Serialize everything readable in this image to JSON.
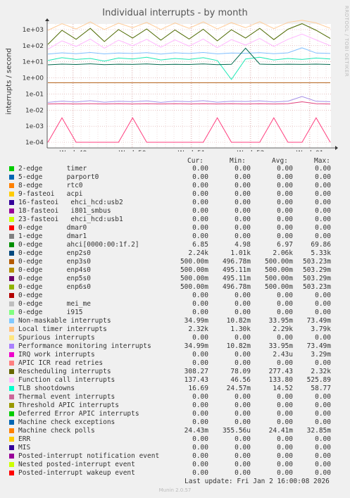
{
  "chart_data": {
    "type": "line",
    "title": "Individual interrupts - by month",
    "ylabel": "interrupts / second",
    "yscale": "log",
    "ylim": [
      0.0001,
      5000
    ],
    "y_ticks": [
      "1e+03",
      "1e+02",
      "1e+01",
      "1e+00",
      "1e-01",
      "1e-02",
      "1e-03",
      "1e-04"
    ],
    "x_ticks": [
      "Week 49",
      "Week 50",
      "Week 51",
      "Week 52",
      "Week 01"
    ],
    "grid": true,
    "series": [
      {
        "name": "Rescheduling interrupts",
        "color": "#4d6a00",
        "avg": 277.43,
        "values": [
          120,
          900,
          250,
          1200,
          180,
          1000,
          300,
          1100,
          220,
          950,
          260,
          1050,
          200,
          980,
          300,
          1200,
          240,
          1050,
          2320,
          900,
          280
        ]
      },
      {
        "name": "Local timer interrupts",
        "color": "#ffcc99",
        "avg": 2290,
        "values": [
          900,
          2300,
          1100,
          3000,
          1000,
          2500,
          1300,
          2800,
          1000,
          2600,
          1200,
          3000,
          1100,
          2700,
          1300,
          3100,
          1150,
          2800,
          3790,
          2600,
          1200
        ]
      },
      {
        "name": "Function call interrupts",
        "color": "#ffb8ff",
        "avg": 133.8,
        "values": [
          60,
          200,
          90,
          260,
          70,
          220,
          100,
          250,
          80,
          230,
          95,
          260,
          75,
          240,
          110,
          280,
          90,
          250,
          525.89,
          230,
          100
        ]
      },
      {
        "name": "Non-maskable interrupts",
        "color": "#7fbfff",
        "avg": 33.95,
        "values": [
          30,
          36,
          32,
          38,
          31,
          35,
          33,
          37,
          30,
          36,
          33,
          38,
          31,
          35,
          34,
          37,
          32,
          36,
          73.49,
          35,
          33
        ]
      },
      {
        "name": "TLB shootdowns",
        "color": "#1ee9b6",
        "avg": 14.52,
        "values": [
          12,
          18,
          14,
          16,
          11,
          17,
          15,
          19,
          13,
          16,
          14,
          18,
          12,
          0.8,
          15,
          19,
          13,
          16,
          14,
          17,
          15
        ]
      },
      {
        "name": "ahci[0000:00:1f.2]",
        "color": "#00694d",
        "avg": 6.97,
        "values": [
          6.5,
          7.2,
          6.8,
          7.5,
          6.6,
          7.1,
          6.9,
          7.4,
          6.7,
          7.0,
          6.8,
          7.3,
          6.6,
          7.0,
          69.86,
          7.2,
          6.8,
          7.1,
          6.9,
          7.2,
          6.85
        ]
      },
      {
        "name": "enp3s0",
        "color": "#b5651d",
        "avg": 0.5,
        "values": [
          0.5,
          0.5,
          0.5,
          0.5,
          0.5,
          0.5,
          0.5,
          0.5,
          0.5,
          0.5,
          0.5,
          0.5,
          0.5,
          0.5,
          0.5,
          0.5,
          0.5,
          0.5,
          0.5,
          0.5,
          0.5
        ]
      },
      {
        "name": "Performance monitoring interrupts",
        "color": "#a48fe8",
        "avg": 0.034,
        "values": [
          0.03,
          0.036,
          0.032,
          0.038,
          0.031,
          0.035,
          0.033,
          0.037,
          0.03,
          0.036,
          0.033,
          0.038,
          0.031,
          0.035,
          0.034,
          0.037,
          0.032,
          0.036,
          0.07,
          0.035,
          0.033
        ]
      },
      {
        "name": "Machine check polls",
        "color": "#e0427c",
        "avg": 0.0241,
        "values": [
          0.024,
          0.025,
          0.024,
          0.025,
          0.024,
          0.025,
          0.024,
          0.025,
          0.024,
          0.025,
          0.024,
          0.025,
          0.024,
          0.025,
          0.024,
          0.025,
          0.024,
          0.025,
          0.0328,
          0.025,
          0.024
        ]
      },
      {
        "name": "IRQ work interrupts",
        "color": "#ff3f7f",
        "avg": 0.00243,
        "values": [
          0.0001,
          0.00329,
          0.0001,
          0.0001,
          0.0001,
          0.0001,
          0.00329,
          0.0001,
          0.0001,
          0.0001,
          0.0001,
          0.0001,
          0.00329,
          0.0001,
          0.0001,
          0.0001,
          0.00329,
          0.0001,
          0.0001,
          0.00329,
          0.0001
        ]
      }
    ]
  },
  "legend": {
    "headers": [
      "Cur:",
      "Min:",
      "Avg:",
      "Max:"
    ],
    "rows": [
      {
        "name": "2-edge      timer",
        "color": "#00cc00",
        "cur": "0.00",
        "min": "0.00",
        "avg": "0.00",
        "max": "0.00"
      },
      {
        "name": "5-edge      parport0",
        "color": "#0066b3",
        "cur": "0.00",
        "min": "0.00",
        "avg": "0.00",
        "max": "0.00"
      },
      {
        "name": "8-edge      rtc0",
        "color": "#ff8000",
        "cur": "0.00",
        "min": "0.00",
        "avg": "0.00",
        "max": "0.00"
      },
      {
        "name": "9-fasteoi   acpi",
        "color": "#ffcc00",
        "cur": "0.00",
        "min": "0.00",
        "avg": "0.00",
        "max": "0.00"
      },
      {
        "name": "16-fasteoi   ehci_hcd:usb2",
        "color": "#330099",
        "cur": "0.00",
        "min": "0.00",
        "avg": "0.00",
        "max": "0.00"
      },
      {
        "name": "18-fasteoi   i801_smbus",
        "color": "#990099",
        "cur": "0.00",
        "min": "0.00",
        "avg": "0.00",
        "max": "0.00"
      },
      {
        "name": "23-fasteoi   ehci_hcd:usb1",
        "color": "#ccff00",
        "cur": "0.00",
        "min": "0.00",
        "avg": "0.00",
        "max": "0.00"
      },
      {
        "name": "0-edge      dmar0",
        "color": "#ff0000",
        "cur": "0.00",
        "min": "0.00",
        "avg": "0.00",
        "max": "0.00"
      },
      {
        "name": "1-edge      dmar1",
        "color": "#808080",
        "cur": "0.00",
        "min": "0.00",
        "avg": "0.00",
        "max": "0.00"
      },
      {
        "name": "0-edge      ahci[0000:00:1f.2]",
        "color": "#008f00",
        "cur": "6.85",
        "min": "4.98",
        "avg": "6.97",
        "max": "69.86"
      },
      {
        "name": "0-edge      enp2s0",
        "color": "#00487d",
        "cur": "2.24k",
        "min": "1.01k",
        "avg": "2.06k",
        "max": "5.33k"
      },
      {
        "name": "0-edge      enp3s0",
        "color": "#b35a00",
        "cur": "500.00m",
        "min": "496.78m",
        "avg": "500.00m",
        "max": "503.23m"
      },
      {
        "name": "0-edge      enp4s0",
        "color": "#b38f00",
        "cur": "500.00m",
        "min": "495.11m",
        "avg": "500.00m",
        "max": "503.29m"
      },
      {
        "name": "0-edge      enp5s0",
        "color": "#6b006b",
        "cur": "500.00m",
        "min": "495.11m",
        "avg": "500.00m",
        "max": "503.29m"
      },
      {
        "name": "0-edge      enp6s0",
        "color": "#8fb300",
        "cur": "500.00m",
        "min": "496.78m",
        "avg": "500.00m",
        "max": "503.23m"
      },
      {
        "name": "0-edge",
        "color": "#b30000",
        "cur": "0.00",
        "min": "0.00",
        "avg": "0.00",
        "max": "0.00"
      },
      {
        "name": "0-edge      mei_me",
        "color": "#bebebe",
        "cur": "0.00",
        "min": "0.00",
        "avg": "0.00",
        "max": "0.00"
      },
      {
        "name": "0-edge      i915",
        "color": "#80ff80",
        "cur": "0.00",
        "min": "0.00",
        "avg": "0.00",
        "max": "0.00"
      },
      {
        "name": "Non-maskable interrupts",
        "color": "#80c9ff",
        "cur": "34.99m",
        "min": "10.82m",
        "avg": "33.95m",
        "max": "73.49m"
      },
      {
        "name": "Local timer interrupts",
        "color": "#ffc080",
        "cur": "2.32k",
        "min": "1.30k",
        "avg": "2.29k",
        "max": "3.79k"
      },
      {
        "name": "Spurious interrupts",
        "color": "#ffe680",
        "cur": "0.00",
        "min": "0.00",
        "avg": "0.00",
        "max": "0.00"
      },
      {
        "name": "Performance monitoring interrupts",
        "color": "#aa80ff",
        "cur": "34.99m",
        "min": "10.82m",
        "avg": "33.95m",
        "max": "73.49m"
      },
      {
        "name": "IRQ work interrupts",
        "color": "#ee00cc",
        "cur": "0.00",
        "min": "0.00",
        "avg": "2.43u",
        "max": "3.29m"
      },
      {
        "name": "APIC ICR read retries",
        "color": "#ff8080",
        "cur": "0.00",
        "min": "0.00",
        "avg": "0.00",
        "max": "0.00"
      },
      {
        "name": "Rescheduling interrupts",
        "color": "#666600",
        "cur": "308.27",
        "min": "78.09",
        "avg": "277.43",
        "max": "2.32k"
      },
      {
        "name": "Function call interrupts",
        "color": "#ffbfff",
        "cur": "137.43",
        "min": "46.56",
        "avg": "133.80",
        "max": "525.89"
      },
      {
        "name": "TLB shootdowns",
        "color": "#00ffcc",
        "cur": "16.69",
        "min": "24.57m",
        "avg": "14.52",
        "max": "58.77"
      },
      {
        "name": "Thermal event interrupts",
        "color": "#cc6699",
        "cur": "0.00",
        "min": "0.00",
        "avg": "0.00",
        "max": "0.00"
      },
      {
        "name": "Threshold APIC interrupts",
        "color": "#999900",
        "cur": "0.00",
        "min": "0.00",
        "avg": "0.00",
        "max": "0.00"
      },
      {
        "name": "Deferred Error APIC interrupts",
        "color": "#00cc00",
        "cur": "0.00",
        "min": "0.00",
        "avg": "0.00",
        "max": "0.00"
      },
      {
        "name": "Machine check exceptions",
        "color": "#0066b3",
        "cur": "0.00",
        "min": "0.00",
        "avg": "0.00",
        "max": "0.00"
      },
      {
        "name": "Machine check polls",
        "color": "#ff8000",
        "cur": "24.43m",
        "min": "355.56u",
        "avg": "24.41m",
        "max": "32.85m"
      },
      {
        "name": "ERR",
        "color": "#ffcc00",
        "cur": "0.00",
        "min": "0.00",
        "avg": "0.00",
        "max": "0.00"
      },
      {
        "name": "MIS",
        "color": "#330099",
        "cur": "0.00",
        "min": "0.00",
        "avg": "0.00",
        "max": "0.00"
      },
      {
        "name": "Posted-interrupt notification event",
        "color": "#990099",
        "cur": "0.00",
        "min": "0.00",
        "avg": "0.00",
        "max": "0.00"
      },
      {
        "name": "Nested posted-interrupt event",
        "color": "#ccff00",
        "cur": "0.00",
        "min": "0.00",
        "avg": "0.00",
        "max": "0.00"
      },
      {
        "name": "Posted-interrupt wakeup event",
        "color": "#ff0000",
        "cur": "0.00",
        "min": "0.00",
        "avg": "0.00",
        "max": "0.00"
      }
    ]
  },
  "last_update": "Last update: Fri Jan  2 16:00:08 2026",
  "watermark": "RRDTOOL / TOBI OETIKER",
  "footer": "Munin 2.0.57"
}
